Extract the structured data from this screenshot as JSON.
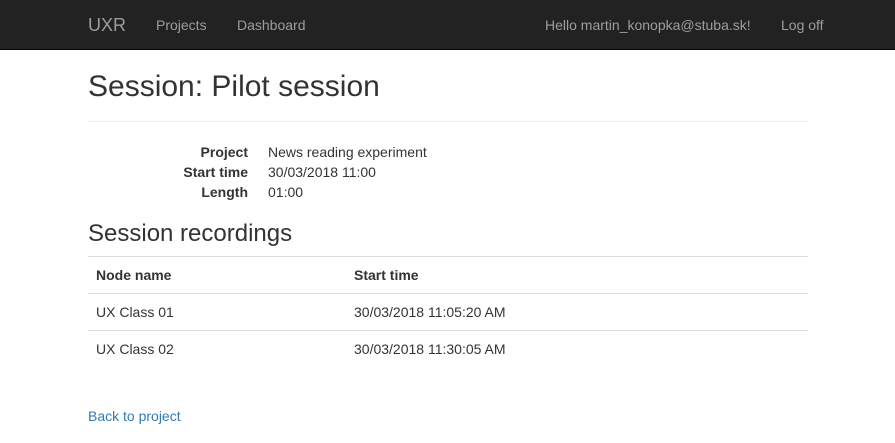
{
  "nav": {
    "brand": "UXR",
    "projects": "Projects",
    "dashboard": "Dashboard",
    "hello": "Hello martin_konopka@stuba.sk!",
    "logoff": "Log off"
  },
  "page": {
    "title": "Session: Pilot session"
  },
  "details": [
    {
      "label": "Project",
      "value": "News reading experiment"
    },
    {
      "label": "Start time",
      "value": "30/03/2018 11:00"
    },
    {
      "label": "Length",
      "value": "01:00"
    }
  ],
  "recordings": {
    "title": "Session recordings",
    "columns": [
      "Node name",
      "Start time"
    ],
    "rows": [
      {
        "node": "UX Class 01",
        "start": "30/03/2018 11:05:20 AM"
      },
      {
        "node": "UX Class 02",
        "start": "30/03/2018 11:30:05 AM"
      }
    ]
  },
  "back_link": "Back to project"
}
